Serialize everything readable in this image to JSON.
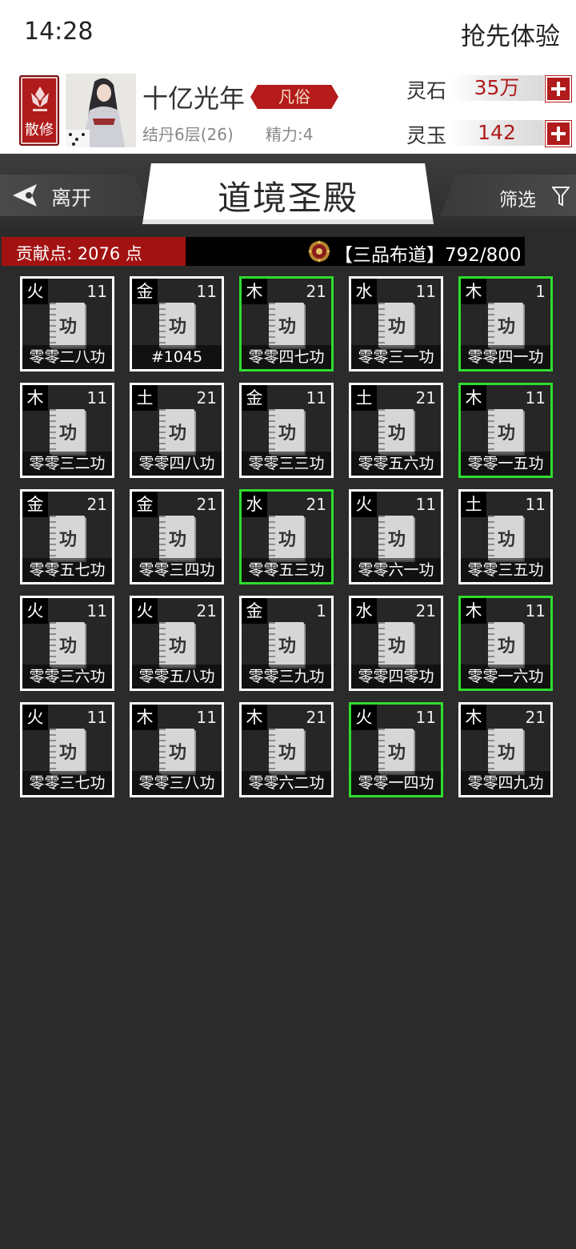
{
  "status_bar": {
    "time": "14:28",
    "right_text": "抢先体验"
  },
  "player": {
    "sect_label": "散修",
    "name": "十亿光年",
    "rank": "凡俗",
    "level": "结丹6层(26)",
    "energy": "精力:4"
  },
  "currencies": [
    {
      "label": "灵石",
      "value": "35万"
    },
    {
      "label": "灵玉",
      "value": "142"
    }
  ],
  "nav": {
    "leave_label": "离开",
    "title": "道境圣殿",
    "filter_label": "筛选"
  },
  "contribution": {
    "text": "贡献点: 2076 点",
    "rank_progress": "【三品布道】792/800"
  },
  "colors": {
    "accent_red": "#b01b1b",
    "highlight_green": "#2fdc2f"
  },
  "cards": [
    {
      "element": "火",
      "count": "11",
      "book_char": "功",
      "name": "零零二八功",
      "highlight": false
    },
    {
      "element": "金",
      "count": "11",
      "book_char": "功",
      "name": "#1045",
      "highlight": false
    },
    {
      "element": "木",
      "count": "21",
      "book_char": "功",
      "name": "零零四七功",
      "highlight": true
    },
    {
      "element": "水",
      "count": "11",
      "book_char": "功",
      "name": "零零三一功",
      "highlight": false
    },
    {
      "element": "木",
      "count": "1",
      "book_char": "功",
      "name": "零零四一功",
      "highlight": true
    },
    {
      "element": "木",
      "count": "11",
      "book_char": "功",
      "name": "零零三二功",
      "highlight": false
    },
    {
      "element": "土",
      "count": "21",
      "book_char": "功",
      "name": "零零四八功",
      "highlight": false
    },
    {
      "element": "金",
      "count": "11",
      "book_char": "功",
      "name": "零零三三功",
      "highlight": false
    },
    {
      "element": "土",
      "count": "21",
      "book_char": "功",
      "name": "零零五六功",
      "highlight": false
    },
    {
      "element": "木",
      "count": "11",
      "book_char": "功",
      "name": "零零一五功",
      "highlight": true
    },
    {
      "element": "金",
      "count": "21",
      "book_char": "功",
      "name": "零零五七功",
      "highlight": false
    },
    {
      "element": "金",
      "count": "21",
      "book_char": "功",
      "name": "零零三四功",
      "highlight": false
    },
    {
      "element": "水",
      "count": "21",
      "book_char": "功",
      "name": "零零五三功",
      "highlight": true
    },
    {
      "element": "火",
      "count": "11",
      "book_char": "功",
      "name": "零零六一功",
      "highlight": false
    },
    {
      "element": "土",
      "count": "11",
      "book_char": "功",
      "name": "零零三五功",
      "highlight": false
    },
    {
      "element": "火",
      "count": "11",
      "book_char": "功",
      "name": "零零三六功",
      "highlight": false
    },
    {
      "element": "火",
      "count": "21",
      "book_char": "功",
      "name": "零零五八功",
      "highlight": false
    },
    {
      "element": "金",
      "count": "1",
      "book_char": "功",
      "name": "零零三九功",
      "highlight": false
    },
    {
      "element": "水",
      "count": "21",
      "book_char": "功",
      "name": "零零四零功",
      "highlight": false
    },
    {
      "element": "木",
      "count": "11",
      "book_char": "功",
      "name": "零零一六功",
      "highlight": true
    },
    {
      "element": "火",
      "count": "11",
      "book_char": "功",
      "name": "零零三七功",
      "highlight": false
    },
    {
      "element": "木",
      "count": "11",
      "book_char": "功",
      "name": "零零三八功",
      "highlight": false
    },
    {
      "element": "木",
      "count": "21",
      "book_char": "功",
      "name": "零零六二功",
      "highlight": false
    },
    {
      "element": "火",
      "count": "11",
      "book_char": "功",
      "name": "零零一四功",
      "highlight": true
    },
    {
      "element": "木",
      "count": "21",
      "book_char": "功",
      "name": "零零四九功",
      "highlight": false
    }
  ]
}
